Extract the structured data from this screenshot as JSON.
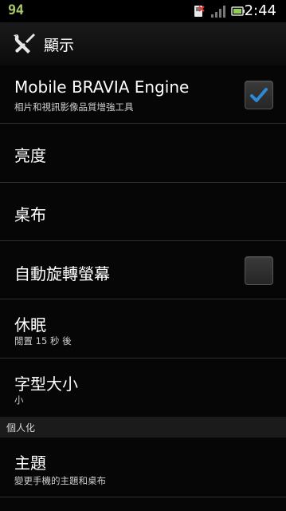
{
  "status_bar": {
    "indicator": "94",
    "time": "2:44",
    "icons": [
      "sim-error-icon",
      "signal-icon",
      "battery-icon"
    ]
  },
  "header": {
    "title": "顯示",
    "icon": "tools-icon"
  },
  "settings": [
    {
      "title": "Mobile BRAVIA Engine",
      "subtitle": "相片和視訊影像品質增強工具",
      "checkbox": true,
      "checked": true
    },
    {
      "title": "亮度"
    },
    {
      "title": "桌布"
    },
    {
      "title": "自動旋轉螢幕",
      "checkbox": true,
      "checked": false
    },
    {
      "title": "休眠",
      "subtitle": "閒置 15 秒 後"
    },
    {
      "title": "字型大小",
      "subtitle": "小"
    }
  ],
  "section": {
    "label": "個人化"
  },
  "personalization": [
    {
      "title": "主題",
      "subtitle": "變更手機的主題和桌布"
    }
  ],
  "colors": {
    "accent_check": "#2f8ad6",
    "indicator_green": "#a9c76a"
  }
}
